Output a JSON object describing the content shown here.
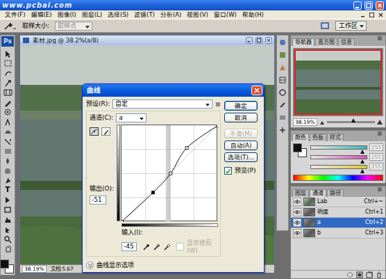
{
  "app": {
    "watermark": "www.pcbai.com"
  },
  "menu": [
    "文件(F)",
    "编辑(E)",
    "图像(I)",
    "图层(L)",
    "选择(S)",
    "滤镜(T)",
    "分析(A)",
    "视图(V)",
    "窗口(W)",
    "帮助(H)"
  ],
  "options_bar": {
    "sample_label": "取样大小:",
    "sample_value": "取样点",
    "workspace": "工作区"
  },
  "toolbar": {
    "logo": "Ps",
    "text_tool": "T"
  },
  "document": {
    "title": "素材.jpg @ 38.2%(a/8)",
    "zoom": "38.19%",
    "info": "文档:5.67"
  },
  "navigator": {
    "tabs": [
      {
        "label": "导航器",
        "selected": true
      },
      {
        "label": "直方图",
        "selected": false
      },
      {
        "label": "信息",
        "selected": false
      }
    ],
    "zoom": "38.19%",
    "slider_level": 0.55
  },
  "color_panel": {
    "tabs": [
      {
        "label": "颜色",
        "selected": true
      },
      {
        "label": "色板",
        "selected": false
      },
      {
        "label": "样式",
        "selected": false
      }
    ],
    "sliders": [
      {
        "value": "255",
        "level": 0.93,
        "color": "#3fb6b0"
      },
      {
        "value": "255",
        "level": 0.93,
        "color": "#d64fb4"
      },
      {
        "value": "255",
        "level": 0.93,
        "color": "#d8c63a"
      }
    ]
  },
  "layers_panel": {
    "tabs": [
      {
        "label": "图层",
        "selected": false
      },
      {
        "label": "通道",
        "selected": true
      },
      {
        "label": "路径",
        "selected": false
      }
    ],
    "channels": [
      {
        "name": "Lab",
        "shortcut": "Ctrl+~",
        "visible": true,
        "selected": false
      },
      {
        "name": "明度",
        "shortcut": "Ctrl+1",
        "visible": true,
        "selected": false
      },
      {
        "name": "a",
        "shortcut": "Ctrl+2",
        "visible": true,
        "selected": true
      },
      {
        "name": "b",
        "shortcut": "Ctrl+3",
        "visible": true,
        "selected": false
      }
    ]
  },
  "curves_dialog": {
    "title": "曲线",
    "preset_label": "预设(R):",
    "preset": "自定",
    "channel_label": "通道(C):",
    "channel": "a",
    "buttons": [
      {
        "label": "确定",
        "default": true,
        "disabled": false
      },
      {
        "label": "取消",
        "default": false,
        "disabled": false
      },
      {
        "label": "平滑(M)",
        "default": false,
        "disabled": true
      },
      {
        "label": "自动(A)",
        "default": false,
        "disabled": false
      },
      {
        "label": "选项(T)...",
        "default": false,
        "disabled": false
      }
    ],
    "preview": {
      "label": "预览(P)",
      "checked": true
    },
    "output_label": "输出(O):",
    "output": "-51",
    "input_label": "输入(I):",
    "input": "-45",
    "show_clipping": {
      "label": "显示修剪(W)",
      "checked": false,
      "disabled": true
    },
    "display_options": {
      "label": "曲线显示选项",
      "expanded": false
    },
    "histogram": {
      "from": 117,
      "to": 130
    },
    "curve": {
      "points": [
        {
          "input": 0,
          "output": 0,
          "selected": false
        },
        {
          "input": 83,
          "output": 77,
          "selected": true
        },
        {
          "input": 130,
          "output": 128,
          "selected": false
        },
        {
          "input": 173,
          "output": 196,
          "selected": false
        },
        {
          "input": 255,
          "output": 255,
          "selected": false
        }
      ]
    }
  }
}
